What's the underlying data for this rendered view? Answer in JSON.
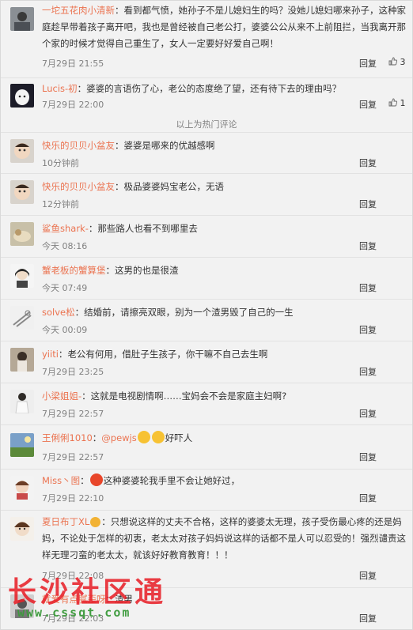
{
  "divider_text": "以上为热门评论",
  "actions": {
    "reply_label": "回复"
  },
  "colors": {
    "username": "#eb7350",
    "text": "#333333",
    "time": "#808080",
    "watermark_red": "#e8222a",
    "watermark_green": "#3a9a3a"
  },
  "comments": [
    {
      "user": "一坨五花肉小清新",
      "sep": "：",
      "text": "看到都气愤，她孙子不是儿媳妇生的吗？没她儿媳妇哪来孙子，这种家庭趁早带着孩子离开吧，我也是曾经被自己老公打，婆婆公公从来不上前阻拦，当我离开那个家的时候才觉得自己重生了，女人一定要好好爱自己啊！",
      "time": "7月29日 21:55",
      "likes": "3"
    },
    {
      "user": "Lucis-初",
      "sep": "：",
      "text": "婆婆的言语伤了心，老公的态度绝了望，还有待下去的理由吗？",
      "time": "7月29日 22:00",
      "likes": "1"
    },
    {
      "user": "快乐的贝贝小盆友",
      "sep": "：",
      "text": "婆婆是哪来的优越感啊",
      "time": "10分钟前",
      "likes": ""
    },
    {
      "user": "快乐的贝贝小盆友",
      "sep": "：",
      "text": "极品婆婆妈宝老公，无语",
      "time": "12分钟前",
      "likes": ""
    },
    {
      "user": "鲨鱼shark-",
      "sep": "：",
      "text": "那些路人也看不到哪里去",
      "time": "今天 08:16",
      "likes": ""
    },
    {
      "user": "蟹老板的蟹算堡",
      "sep": "：",
      "text": "这男的也是很渣",
      "time": "今天 07:49",
      "likes": ""
    },
    {
      "user": "solve松",
      "sep": "：",
      "text": "结婚前，请擦亮双眼，别为一个渣男毁了自己的一生",
      "time": "今天 00:09",
      "likes": ""
    },
    {
      "user": "yiiti",
      "sep": "：",
      "text": "老公有何用，借肚子生孩子，你干嘛不自己去生啊",
      "time": "7月29日 23:25",
      "likes": ""
    },
    {
      "user": "小梁姐姐-",
      "sep": "：",
      "text": "这就是电视剧情啊……宝妈会不会是家庭主妇啊?",
      "time": "7月29日 22:57",
      "likes": ""
    },
    {
      "user": "王俐俐1010",
      "sep": "：",
      "mention": "@pewjs",
      "text": "好吓人",
      "time": "7月29日 22:57",
      "likes": ""
    },
    {
      "user": "Miss丶图",
      "sep": "：",
      "text": "这种婆婆轮我手里不会让她好过，",
      "time": "7月29日 22:10",
      "likes": ""
    },
    {
      "user": "夏日布丁XL",
      "sep": "：",
      "text": "只想说这样的丈夫不合格，这样的婆婆太无理，孩子受伤最心疼的还是妈妈，不论处于怎样的初衷，老太太对孩子妈妈说这样的话都不是人可以忍受的！强烈谴责这样无理刁蛮的老太太，就该好好教育教育！！！",
      "time": "7月29日 22:08",
      "likes": ""
    },
    {
      "user": "就爱有点腻歪呀",
      "sep": "：",
      "text": "渣男",
      "time": "7月29日 22:03",
      "likes": ""
    }
  ],
  "watermark": {
    "line1": "长沙社区通",
    "line2": "www.cssqt.com"
  }
}
